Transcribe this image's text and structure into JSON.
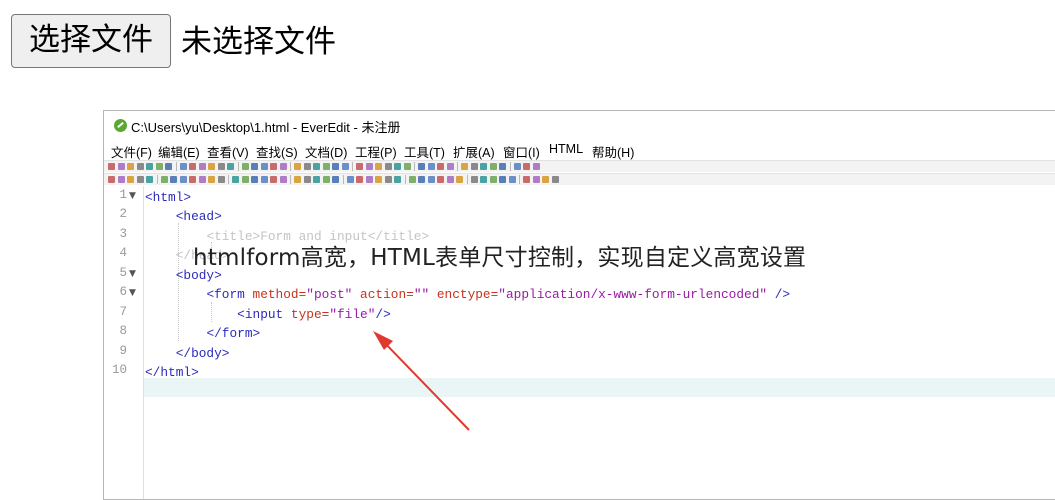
{
  "file_input": {
    "button_label": "选择文件",
    "status": "未选择文件"
  },
  "window": {
    "title": "C:\\Users\\yu\\Desktop\\1.html - EverEdit - 未注册",
    "menu": [
      "文件(F)",
      "编辑(E)",
      "查看(V)",
      "查找(S)",
      "文档(D)",
      "工程(P)",
      "工具(T)",
      "扩展(A)",
      "窗口(I)",
      "HTML",
      "帮助(H)"
    ]
  },
  "editor": {
    "line_numbers": [
      "1",
      "2",
      "3",
      "4",
      "5",
      "6",
      "7",
      "8",
      "9",
      "10"
    ],
    "lines": [
      {
        "indent": "",
        "t1": "<html>"
      },
      {
        "indent": "    ",
        "t1": "<head>"
      },
      {
        "indent": "        ",
        "t1": "<title>Form and input</title>"
      },
      {
        "indent": "    ",
        "t1": "</head>"
      },
      {
        "indent": "    ",
        "t1": "<body>"
      },
      {
        "indent": "        ",
        "tag_open": "<form ",
        "a1": "method=",
        "v1": "\"post\" ",
        "a2": "action=",
        "v2": "\"\" ",
        "a3": "enctype=",
        "v3": "\"application/x-www-form-urlencoded\"",
        "tag_close": " />"
      },
      {
        "indent": "            ",
        "tag_open": "<input ",
        "a1": "type=",
        "v1": "\"file\"",
        "tag_close": "/>"
      },
      {
        "indent": "        ",
        "t1": "</form>"
      },
      {
        "indent": "    ",
        "t1": "</body>"
      },
      {
        "indent": "",
        "t1": "</html>"
      }
    ]
  },
  "overlay_caption": "htmlform高宽，HTML表单尺寸控制，实现自定义高宽设置",
  "colors": {
    "tag": "#2b2bbd",
    "attribute": "#c8321e",
    "string": "#9a1aa8",
    "arrow": "#e03a2e",
    "current_line": "#eaf6f6"
  }
}
